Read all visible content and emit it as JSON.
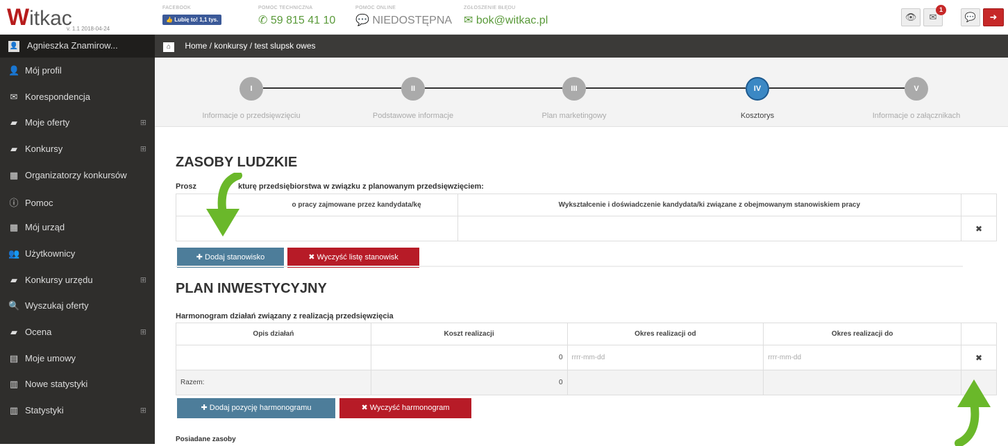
{
  "brand": {
    "logo_text": "Witkac",
    "version": "v. 1.1 2018-04-24"
  },
  "topbar": {
    "facebook": {
      "label": "FACEBOOK",
      "button": "Lubię to! 1,1 tys."
    },
    "tech_help": {
      "label": "POMOC TECHNICZNA",
      "value": "59 815 41 10"
    },
    "online_help": {
      "label": "POMOC ONLINE",
      "value": "NIEDOSTĘPNA"
    },
    "bug_report": {
      "label": "ZGŁOSZENIE BŁĘDU",
      "value": "bok@witkac.pl"
    },
    "notification_count": "1",
    "icons": [
      "eye-icon",
      "envelope-icon",
      "chat-icon",
      "logout-icon"
    ]
  },
  "sidebar": {
    "user_name": "Agnieszka Znamirow...",
    "items": [
      {
        "label": "Mój profil",
        "icon": "user-icon",
        "expand": false
      },
      {
        "label": "Korespondencja",
        "icon": "envelope-icon",
        "expand": false
      },
      {
        "label": "Moje oferty",
        "icon": "book-icon",
        "expand": true
      },
      {
        "label": "Konkursy",
        "icon": "book-icon",
        "expand": true
      },
      {
        "label": "Organizatorzy konkursów",
        "icon": "building-icon",
        "expand": false
      },
      {
        "label": "Pomoc",
        "icon": "info-icon",
        "expand": false
      },
      {
        "label": "Mój urząd",
        "icon": "building-icon",
        "expand": false
      },
      {
        "label": "Użytkownicy",
        "icon": "users-icon",
        "expand": false
      },
      {
        "label": "Konkursy urzędu",
        "icon": "book-icon",
        "expand": true
      },
      {
        "label": "Wyszukaj oferty",
        "icon": "search-icon",
        "expand": false
      },
      {
        "label": "Ocena",
        "icon": "book-icon",
        "expand": true
      },
      {
        "label": "Moje umowy",
        "icon": "file-icon",
        "expand": false
      },
      {
        "label": "Nowe statystyki",
        "icon": "bar-chart-icon",
        "expand": false
      },
      {
        "label": "Statystyki",
        "icon": "bar-chart-icon",
        "expand": true
      }
    ]
  },
  "breadcrumb": {
    "home": "Home",
    "sep": "/",
    "level1": "konkursy",
    "level2": "test slupsk owes"
  },
  "wizard": {
    "steps": [
      {
        "numeral": "I",
        "label": "Informacje o przedsięwzięciu",
        "active": false
      },
      {
        "numeral": "II",
        "label": "Podstawowe informacje",
        "active": false
      },
      {
        "numeral": "III",
        "label": "Plan marketingowy",
        "active": false
      },
      {
        "numeral": "IV",
        "label": "Kosztorys",
        "active": true
      },
      {
        "numeral": "V",
        "label": "Informacje o załącznikach",
        "active": false
      }
    ],
    "colors": {
      "active": "#3b88c4",
      "inactive": "#aaaaaa"
    }
  },
  "section1": {
    "title": "ZASOBY LUDZKIE",
    "instruction_start": "Prosz",
    "instruction_end": "kturę przedsiębiorstwa w związku z planowanym przedsięwzięciem:",
    "columns": [
      "o pracy zajmowane przez kandydata/kę",
      "Wykształcenie i doświadczenie kandydata/ki związane z obejmowanym stanowiskiem pracy"
    ],
    "add_button": "Dodaj stanowisko",
    "clear_button": "Wyczyść listę stanowisk"
  },
  "section2": {
    "title": "PLAN INWESTYCYJNY",
    "subtitle": "Harmonogram działań związany z realizacją przedsięwzięcia",
    "columns": [
      "Opis działań",
      "Koszt realizacji",
      "Okres realizacji od",
      "Okres realizacji do"
    ],
    "row": {
      "cost": "0",
      "from_placeholder": "rrrr-mm-dd",
      "to_placeholder": "rrrr-mm-dd"
    },
    "total_label": "Razem:",
    "total_value": "0",
    "add_button": "Dodaj pozycję harmonogramu",
    "clear_button": "Wyczyść harmonogram"
  },
  "section3": {
    "subtitle": "Posiadane zasoby"
  },
  "accent_colors": {
    "arrow": "#6ab82a",
    "primary_button": "#4d7d9a",
    "danger_button": "#b71b27",
    "brand_red": "#b71c1c"
  }
}
